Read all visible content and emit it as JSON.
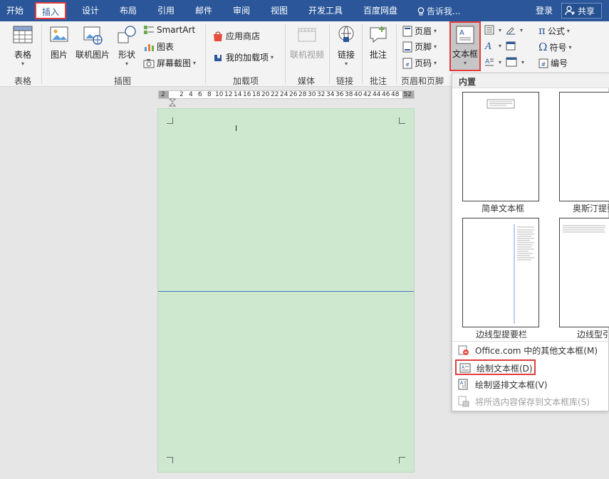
{
  "menubar": {
    "tabs": [
      "开始",
      "插入",
      "设计",
      "布局",
      "引用",
      "邮件",
      "审阅",
      "视图",
      "开发工具",
      "百度网盘"
    ],
    "active_tab": "插入",
    "tell_me": "告诉我...",
    "login": "登录",
    "share": "共享"
  },
  "ribbon": {
    "groups": {
      "table": "表格",
      "illustrations": "插图",
      "addins": "加载项",
      "media": "媒体",
      "links": "链接",
      "comments": "批注",
      "header_footer": "页眉和页脚"
    },
    "buttons": {
      "table": "表格",
      "picture": "图片",
      "online_picture": "联机图片",
      "shapes": "形状",
      "smartart": "SmartArt",
      "chart": "图表",
      "screenshot": "屏幕截图",
      "app_store": "应用商店",
      "my_addins": "我的加载项",
      "online_video": "联机视频",
      "link": "链接",
      "comment": "批注",
      "header": "页眉",
      "footer": "页脚",
      "page_number": "页码",
      "text_box": "文本框",
      "equation": "公式",
      "symbol": "符号",
      "numbering": "编号"
    }
  },
  "ruler": {
    "left_end": "2",
    "right_end": "52",
    "ticks": [
      "2",
      "4",
      "6",
      "8",
      "10",
      "12",
      "14",
      "16",
      "18",
      "20",
      "22",
      "24",
      "26",
      "28",
      "30",
      "32",
      "34",
      "36",
      "38",
      "40",
      "42",
      "44",
      "46",
      "48"
    ]
  },
  "dropdown": {
    "section": "内置",
    "thumbnails": [
      "简单文本框",
      "奥斯汀提要",
      "边线型提要栏",
      "边线型引"
    ],
    "items": [
      {
        "label": "Office.com 中的其他文本框(M)",
        "icon": "office-icon",
        "disabled": false,
        "highlight": false
      },
      {
        "label": "绘制文本框(D)",
        "icon": "textbox-draw-icon",
        "disabled": false,
        "highlight": true
      },
      {
        "label": "绘制竖排文本框(V)",
        "icon": "vertical-textbox-icon",
        "disabled": false,
        "highlight": false
      },
      {
        "label": "将所选内容保存到文本框库(S)",
        "icon": "save-selection-icon",
        "disabled": true,
        "highlight": false
      }
    ]
  },
  "colors": {
    "menubar": "#2b579a",
    "page": "#cde8cf",
    "highlight": "#e23b3b",
    "divider": "#4a73c0"
  }
}
